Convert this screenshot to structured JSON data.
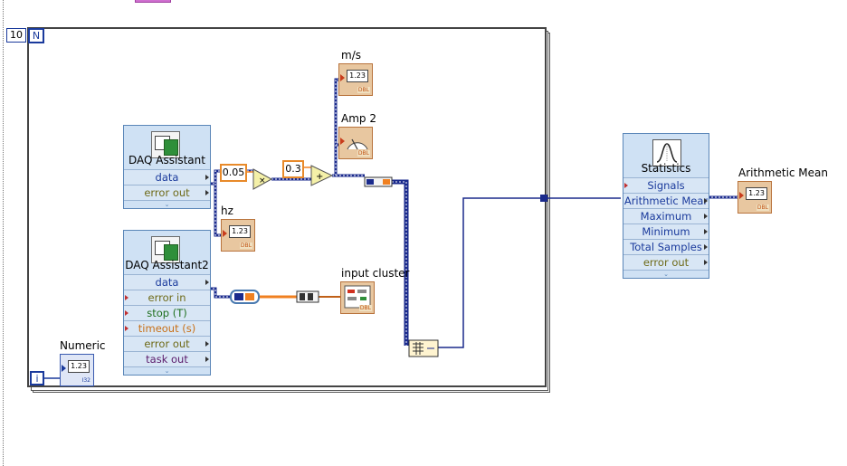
{
  "loop": {
    "count": "10",
    "count_terminal": "N",
    "iteration_terminal": "i"
  },
  "nodes": {
    "daq1": {
      "title": "DAQ Assistant",
      "rows": [
        "data",
        "error out"
      ]
    },
    "daq2": {
      "title": "DAQ Assistant2",
      "rows": [
        "data",
        "error in",
        "stop (T)",
        "timeout (s)",
        "error out",
        "task out"
      ]
    },
    "stats": {
      "title": "Statistics",
      "rows": [
        "Signals",
        "Arithmetic Mear",
        "Maximum",
        "Minimum",
        "Total Samples",
        "error out"
      ]
    }
  },
  "constants": {
    "gain": "0.05",
    "offset": "0.3"
  },
  "indicators": {
    "ms": {
      "label": "m/s",
      "display": "1.23",
      "tag": "DBL"
    },
    "amp2": {
      "label": "Amp 2",
      "tag": "DBL"
    },
    "hz": {
      "label": "hz",
      "display": "1.23",
      "tag": "DBL"
    },
    "input_cluster": {
      "label": "input cluster",
      "tag": "DBL"
    },
    "numeric": {
      "label": "Numeric",
      "display": "1.23",
      "tag": "I32"
    },
    "mean": {
      "label": "Arithmetic Mean",
      "display": "1.23",
      "tag": "DBL"
    }
  },
  "colors": {
    "wire_dbl": "#f08020",
    "wire_dyn": "#1a2a8c",
    "node_bg": "#cfe1f4"
  }
}
